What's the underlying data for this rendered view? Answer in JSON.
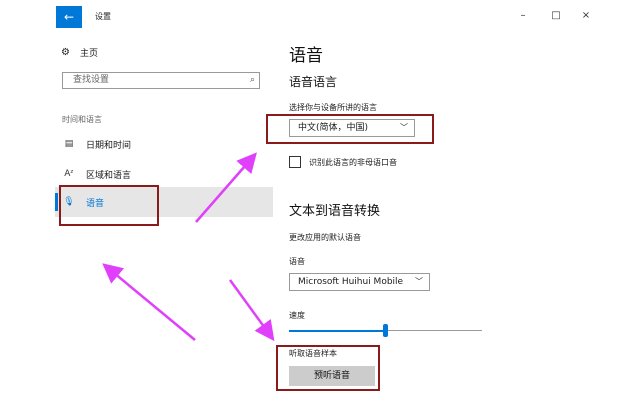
{
  "window": {
    "title": "设置",
    "back_glyph": "←",
    "minimize_glyph": "–",
    "maximize_glyph": "□",
    "close_glyph": "×"
  },
  "sidebar": {
    "home": {
      "label": "主页",
      "icon": "gear-icon"
    },
    "search_placeholder": "查找设置",
    "section_label": "时间和语言",
    "items": [
      {
        "label": "日期和时间",
        "icon": "calendar-icon"
      },
      {
        "label": "区域和语言",
        "icon": "language-icon"
      },
      {
        "label": "语音",
        "icon": "microphone-icon"
      }
    ]
  },
  "main": {
    "page_title": "语音",
    "section1_title": "语音语言",
    "language_prompt": "选择你与设备所讲的语言",
    "language_value": "中文(简体，中国)",
    "checkbox_label": "识别此语言的非母语口音",
    "section2_title": "文本到语音转换",
    "default_voice_text": "更改应用的默认语音",
    "voice_label": "语音",
    "voice_value": "Microsoft Huihui Mobile",
    "speed_label": "速度",
    "speed_value": 0.5,
    "sample_label": "听取语音样本",
    "preview_button": "预听语音"
  },
  "colors": {
    "accent": "#0078d7",
    "annotation_box": "#8b1a1a",
    "annotation_arrow": "#e040fb"
  }
}
